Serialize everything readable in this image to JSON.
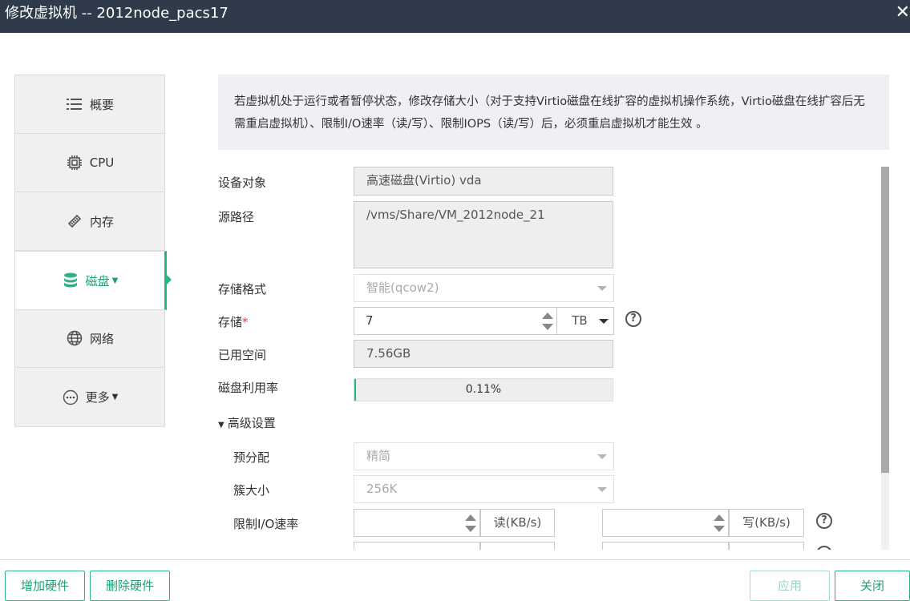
{
  "window": {
    "title": "修改虚拟机 -- 2012node_pacs17",
    "close_glyph": "✕"
  },
  "nav": {
    "items": [
      {
        "label": "概要",
        "icon": "list-icon"
      },
      {
        "label": "CPU",
        "icon": "cpu-chip-icon"
      },
      {
        "label": "内存",
        "icon": "memory-stick-icon"
      },
      {
        "label": "磁盘",
        "icon": "database-icon",
        "active": true
      },
      {
        "label": "网络",
        "icon": "globe-icon"
      },
      {
        "label": "更多",
        "icon": "more-dots-icon"
      }
    ]
  },
  "notice": "若虚拟机处于运行或者暂停状态，修改存储大小（对于支持Virtio磁盘在线扩容的虚拟机操作系统，Virtio磁盘在线扩容后无需重启虚拟机）、限制I/O速率（读/写）、限制IOPS（读/写）后，必须重启虚拟机才能生效 。",
  "form": {
    "device_label": "设备对象",
    "device_value": "高速磁盘(Virtio) vda",
    "source_label": "源路径",
    "source_value": "/vms/Share/VM_2012node_21",
    "format_label": "存储格式",
    "format_value": "智能(qcow2)",
    "storage_label": "存储",
    "storage_required": "*",
    "storage_value": "7",
    "storage_unit": "TB",
    "used_label": "已用空间",
    "used_value": "7.56GB",
    "usage_label": "磁盘利用率",
    "usage_text": "0.11%",
    "usage_fraction": 0.0011,
    "advanced_label": "高级设置",
    "prealloc_label": "预分配",
    "prealloc_value": "精简",
    "cluster_label": "簇大小",
    "cluster_value": "256K",
    "io_label": "限制I/O速率",
    "io_read_unit": "读(KB/s)",
    "io_write_unit": "写(KB/s)",
    "help_glyph": "?"
  },
  "footer": {
    "add_hw": "增加硬件",
    "del_hw": "删除硬件",
    "apply": "应用",
    "close": "关闭"
  },
  "colors": {
    "accent": "#2bb386",
    "titlebar": "#2f3a4a"
  }
}
